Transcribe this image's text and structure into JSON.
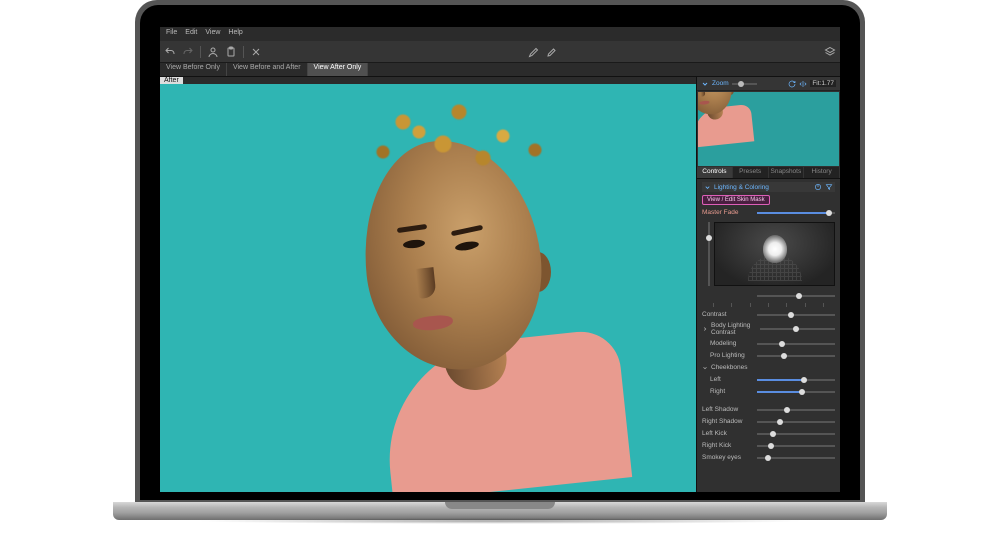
{
  "menus": {
    "file": "File",
    "edit": "Edit",
    "view": "View",
    "help": "Help"
  },
  "viewtabs": {
    "before_only": "View Before Only",
    "before_after": "View Before and After",
    "after_only": "View After Only",
    "active": "after_only"
  },
  "canvas": {
    "badge": "After"
  },
  "zoom": {
    "label": "Zoom",
    "value": "Fit:1.77"
  },
  "side_tabs": {
    "controls": "Controls",
    "presets": "Presets",
    "snapshots": "Snapshots",
    "history": "History",
    "active": "controls"
  },
  "section": {
    "title": "Lighting & Coloring",
    "skin_button": "View / Edit Skin Mask"
  },
  "sliders": {
    "master_fade": {
      "label": "Master Fade",
      "value": 92
    },
    "face_hslider": {
      "value": 54
    },
    "contrast": {
      "label": "Contrast",
      "value": 44
    },
    "body_lighting": {
      "label": "Body Lighting Contrast",
      "value": 48
    },
    "modeling": {
      "label": "Modeling",
      "value": 32
    },
    "pro_lighting": {
      "label": "Pro Lighting",
      "value": 35
    },
    "cheekbones": {
      "label": "Cheekbones"
    },
    "cheek_left": {
      "label": "Left",
      "value": 60
    },
    "cheek_right": {
      "label": "Right",
      "value": 58
    },
    "left_shadow": {
      "label": "Left Shadow",
      "value": 38
    },
    "right_shadow": {
      "label": "Right Shadow",
      "value": 30
    },
    "left_kick": {
      "label": "Left Kick",
      "value": 20
    },
    "right_kick": {
      "label": "Right Kick",
      "value": 18
    },
    "smokey_eyes": {
      "label": "Smokey eyes",
      "value": 14
    }
  },
  "colors": {
    "accent": "#5a8de0",
    "link": "#6db7ff",
    "magenta": "#de5fb8"
  }
}
